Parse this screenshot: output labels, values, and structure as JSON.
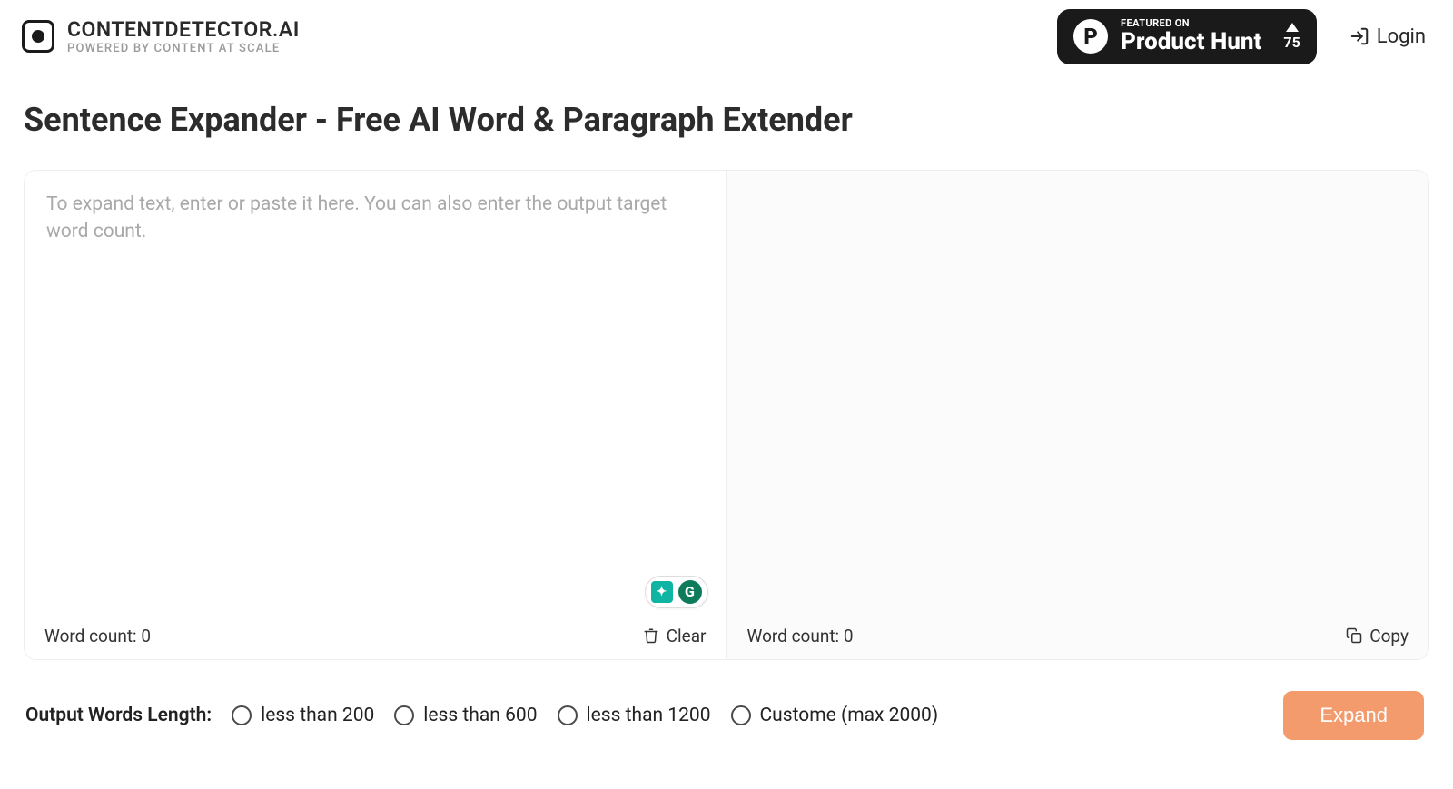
{
  "brand": {
    "title": "CONTENTDETECTOR.AI",
    "subtitle": "POWERED BY CONTENT AT SCALE"
  },
  "product_hunt": {
    "featured_label": "FEATURED ON",
    "name": "Product Hunt",
    "votes": "75"
  },
  "header": {
    "login": "Login"
  },
  "page": {
    "title": "Sentence Expander - Free AI Word & Paragraph Extender"
  },
  "editor": {
    "input_placeholder": "To expand text, enter or paste it here. You can also enter the output target word count.",
    "input_value": "",
    "output_value": "",
    "word_count_label": "Word count:",
    "input_word_count": "0",
    "output_word_count": "0",
    "clear_label": "Clear",
    "copy_label": "Copy"
  },
  "options": {
    "label": "Output Words Length:",
    "items": [
      "less than 200",
      "less than 600",
      "less than 1200",
      "Custome (max 2000)"
    ],
    "expand_button": "Expand"
  }
}
